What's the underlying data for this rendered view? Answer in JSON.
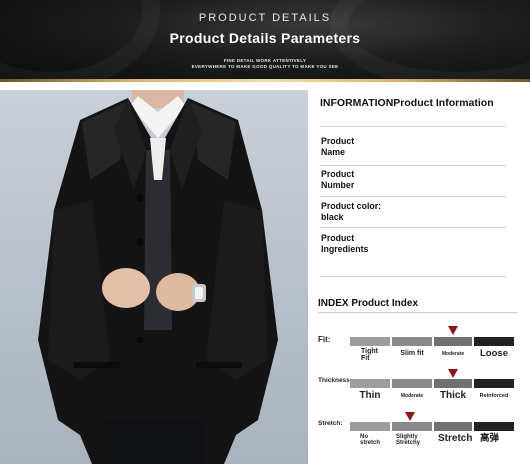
{
  "banner": {
    "subtitle": "PRODUCT DETAILS",
    "title": "Product Details Parameters",
    "line1": "FINE DETAIL WORK ATTENTIVELY",
    "line2": "EVERYWHERE TO MAKE GOOD QUALITY TO MAKE YOU SEE"
  },
  "photo": {
    "subject": "man in black leather coat with white shirt and wristwatch"
  },
  "information": {
    "title": "INFORMATIONProduct Information",
    "rows": [
      {
        "label": "Product\nName"
      },
      {
        "label": "Product\nNumber"
      },
      {
        "label": "Product color:\nblack"
      },
      {
        "label": "Product\nIngredients"
      }
    ]
  },
  "index": {
    "title": "INDEX Product Index",
    "scales": [
      {
        "label": "Fit:",
        "options": [
          "Tight\nFit",
          "Slim fit",
          "Moderate",
          "Loose"
        ],
        "selected": 2
      },
      {
        "label": "Thickness:",
        "options": [
          "Thin",
          "Moderate",
          "Thick",
          "Reinforced"
        ],
        "selected": 2
      },
      {
        "label": "Stretch:",
        "options": [
          "No\nstretch",
          "Slightly\nStretchy",
          "Stretch",
          "高弹"
        ],
        "selected": 1
      }
    ]
  },
  "colors": {
    "banner_bg": "#1a1a1a",
    "gold_rule": "#d8b46a",
    "marker": "#8f1616",
    "segments": [
      "#9d9d9d",
      "#8a8a8a",
      "#707070",
      "#222222"
    ]
  }
}
